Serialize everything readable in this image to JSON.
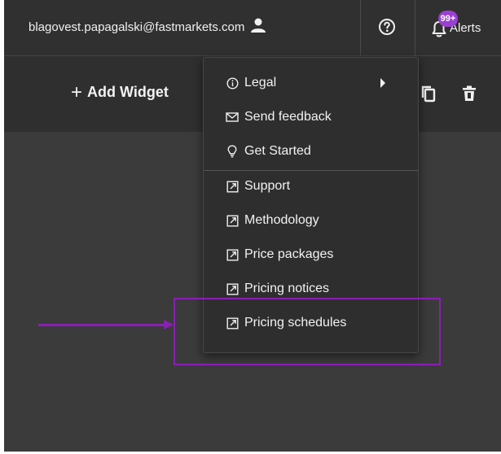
{
  "header": {
    "user_email": "blagovest.papagalski@fastmarkets.com",
    "user_icon": "user-icon",
    "help_icon": "question-circle-icon",
    "alerts_label": "Alerts",
    "alerts_badge": "99+",
    "alerts_icon": "bell-icon"
  },
  "toolbar": {
    "add_widget_label": "Add Widget",
    "add_widget_icon": "plus-icon",
    "copy_icon": "copy-icon",
    "delete_icon": "trash-icon"
  },
  "menu": {
    "items": [
      {
        "label": "Legal",
        "icon": "info-circle-icon",
        "has_submenu": true
      },
      {
        "label": "Send feedback",
        "icon": "envelope-icon"
      },
      {
        "label": "Get Started",
        "icon": "lightbulb-icon"
      },
      {
        "label": "Support",
        "icon": "external-link-icon"
      },
      {
        "label": "Methodology",
        "icon": "external-link-icon"
      },
      {
        "label": "Price packages",
        "icon": "external-link-icon"
      },
      {
        "label": "Pricing notices",
        "icon": "external-link-icon"
      },
      {
        "label": "Pricing schedules",
        "icon": "external-link-icon"
      }
    ]
  },
  "annotation": {
    "color": "#8a1fb5",
    "target": "Pricing schedules"
  },
  "colors": {
    "topbar_bg": "#303030",
    "toolbar_bg": "#2f2f2f",
    "canvas_bg": "#3b3b3b",
    "menu_bg": "#2e2e2e",
    "badge_bg": "#9b3fd2",
    "text": "#f2f2f2"
  }
}
